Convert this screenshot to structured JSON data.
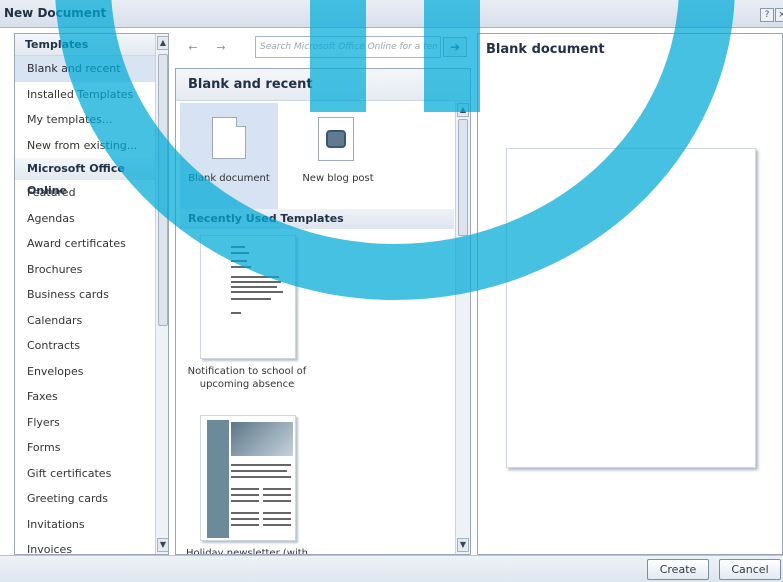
{
  "window": {
    "title": "New Document",
    "help_glyph": "?",
    "close_glyph": "×"
  },
  "left_panel": {
    "header": "Templates",
    "items": [
      {
        "label": "Blank and recent",
        "selected": true
      },
      {
        "label": "Installed Templates"
      },
      {
        "label": "My templates..."
      },
      {
        "label": "New from existing..."
      }
    ],
    "online_header": "Microsoft Office Online",
    "online_items": [
      "Featured",
      "Agendas",
      "Award certificates",
      "Brochures",
      "Business cards",
      "Calendars",
      "Contracts",
      "Envelopes",
      "Faxes",
      "Flyers",
      "Forms",
      "Gift certificates",
      "Greeting cards",
      "Invitations",
      "Invoices"
    ]
  },
  "toolbar": {
    "back_glyph": "←",
    "forward_glyph": "→",
    "search_placeholder": "Search Microsoft Office Online for a ten",
    "go_glyph": "➔"
  },
  "middle_panel": {
    "title": "Blank and recent",
    "tiles": [
      {
        "label": "Blank document",
        "selected": true
      },
      {
        "label": "New blog post"
      }
    ],
    "recent_header": "Recently Used Templates",
    "recent_templates": [
      {
        "label": "Notification to school of upcoming absence"
      },
      {
        "label": "Holiday newsletter (with"
      }
    ]
  },
  "preview": {
    "title": "Blank document"
  },
  "footer": {
    "create_label": "Create",
    "cancel_label": "Cancel"
  },
  "scroll_glyphs": {
    "up": "▲",
    "down": "▼"
  }
}
